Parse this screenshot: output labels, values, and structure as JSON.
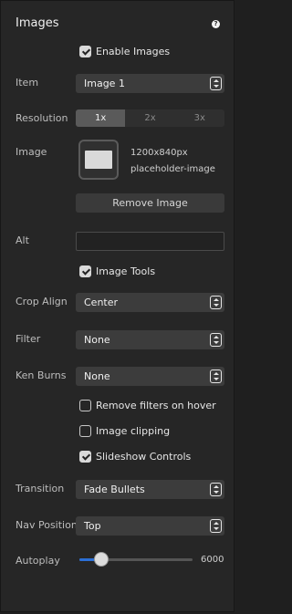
{
  "panel": {
    "title": "Images"
  },
  "enable_images": {
    "label": "Enable Images",
    "checked": true
  },
  "item": {
    "label": "Item",
    "value": "Image 1"
  },
  "resolution": {
    "label": "Resolution",
    "options": [
      "1x",
      "2x",
      "3x"
    ],
    "selected": "1x"
  },
  "image": {
    "label": "Image",
    "size": "1200x840px",
    "name": "placeholder-image",
    "remove_label": "Remove Image"
  },
  "alt": {
    "label": "Alt",
    "value": ""
  },
  "image_tools": {
    "label": "Image Tools",
    "checked": true
  },
  "crop_align": {
    "label": "Crop Align",
    "value": "Center"
  },
  "filter": {
    "label": "Filter",
    "value": "None"
  },
  "ken_burns": {
    "label": "Ken Burns",
    "value": "None"
  },
  "remove_filters": {
    "label": "Remove filters on hover",
    "checked": false
  },
  "image_clipping": {
    "label": "Image clipping",
    "checked": false
  },
  "slideshow_controls": {
    "label": "Slideshow Controls",
    "checked": true
  },
  "transition": {
    "label": "Transition",
    "value": "Fade Bullets"
  },
  "nav_position": {
    "label": "Nav Position",
    "value": "Top"
  },
  "autoplay": {
    "label": "Autoplay",
    "value": "6000",
    "fraction": 0.19
  },
  "colors": {
    "accent": "#2b6fd6"
  }
}
